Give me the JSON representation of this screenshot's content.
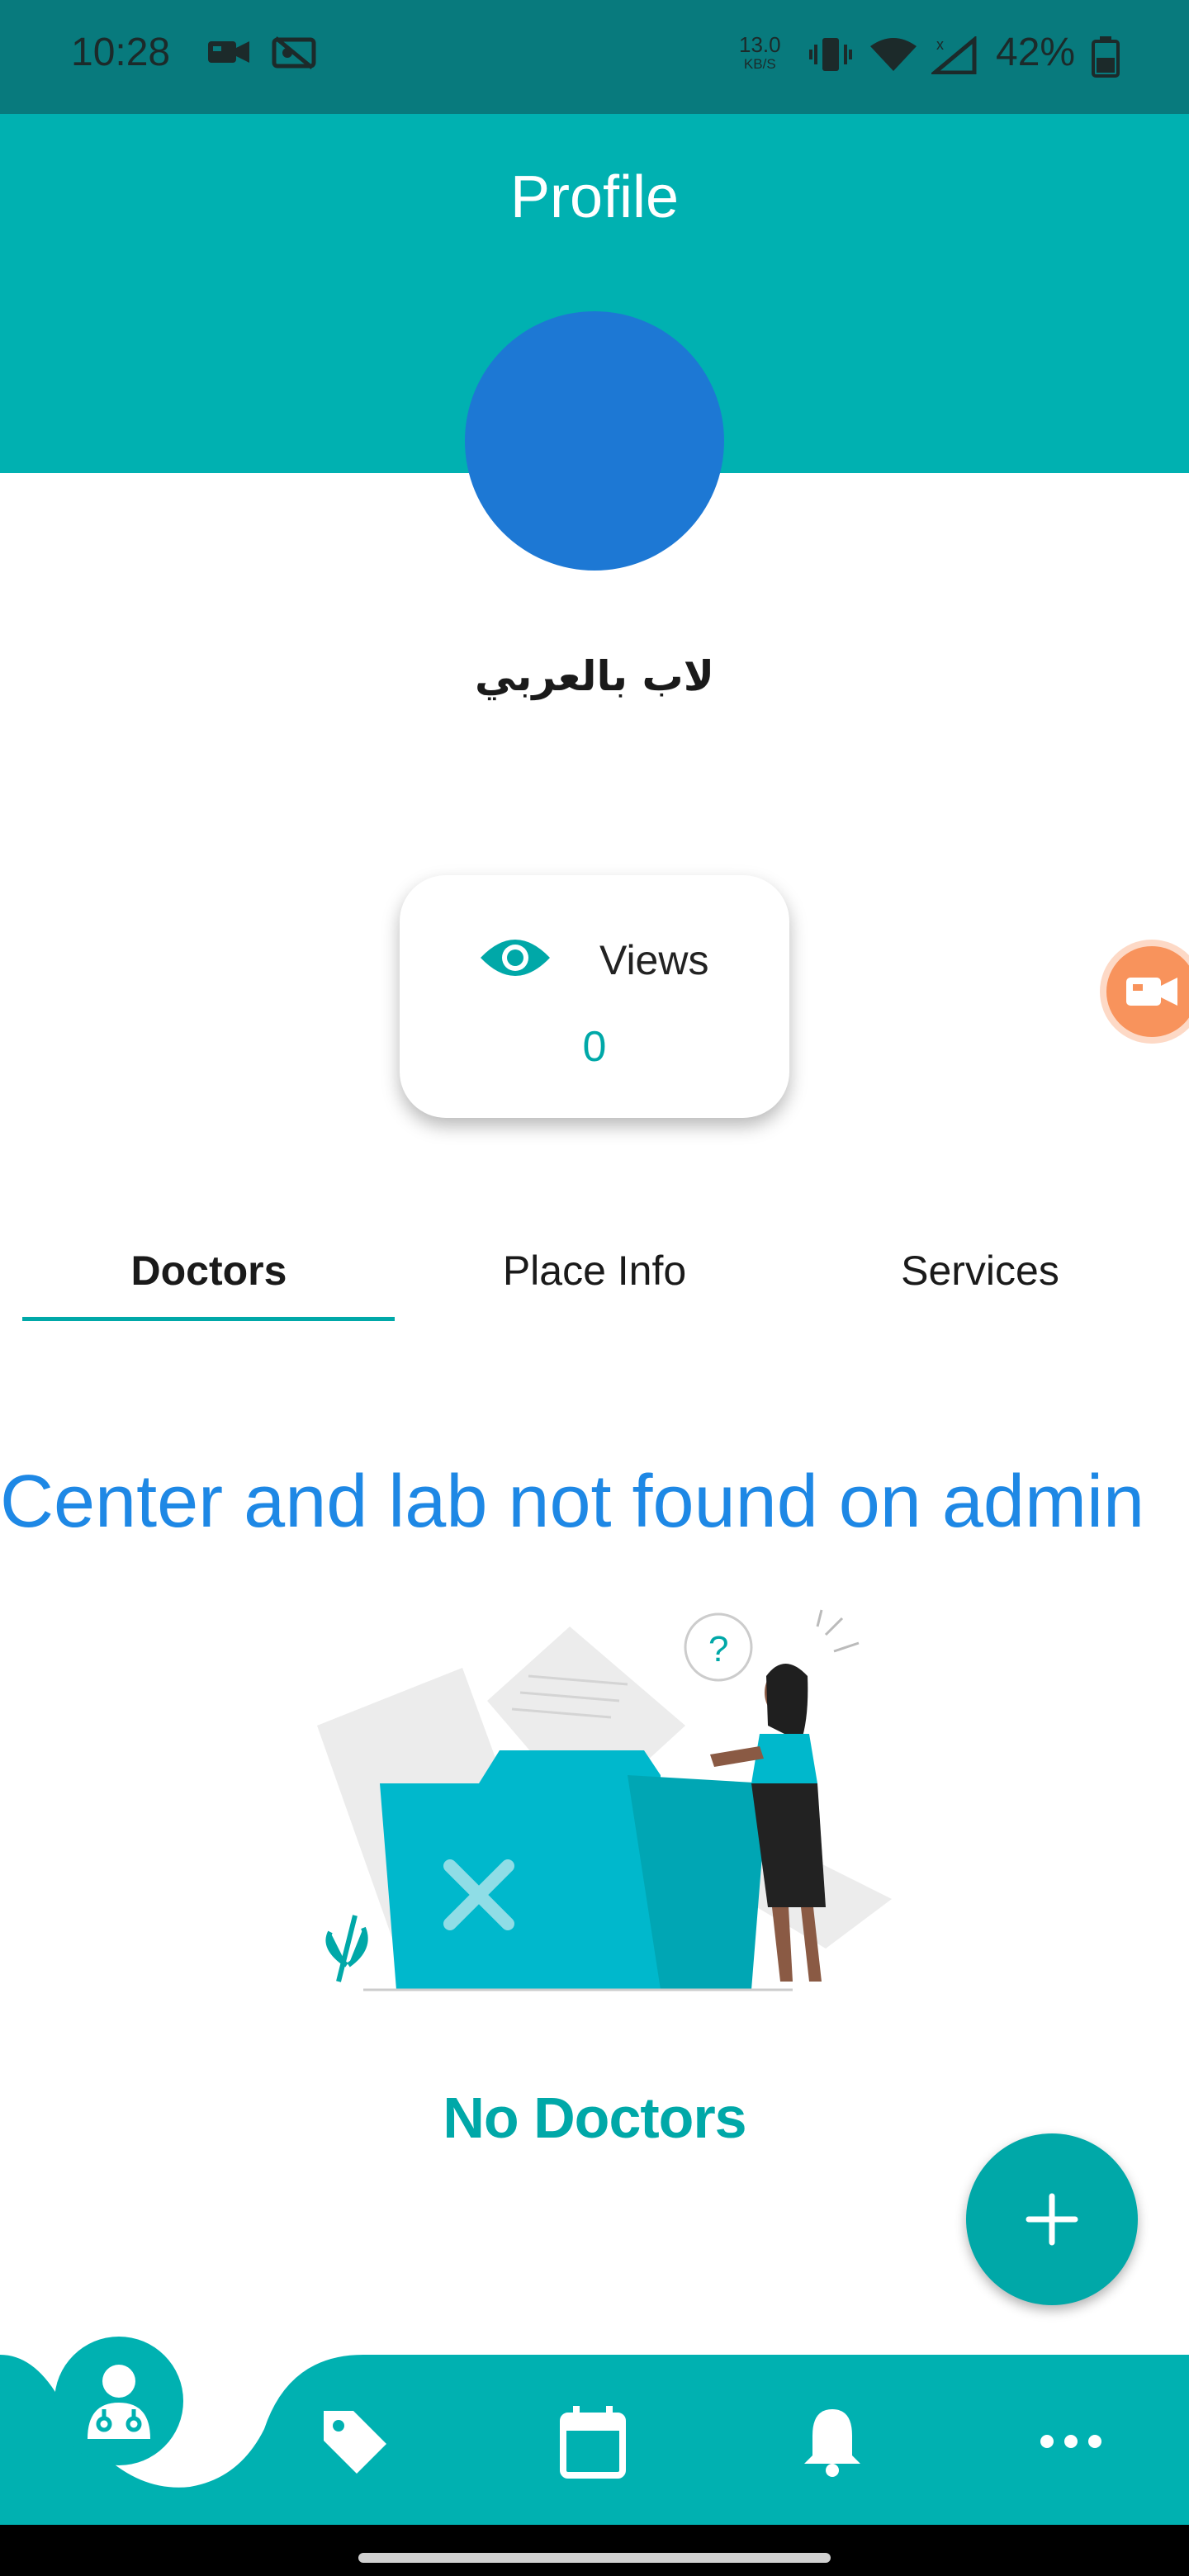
{
  "status_bar": {
    "time": "10:28",
    "net_speed_value": "13.0",
    "net_speed_unit": "KB/S",
    "battery": "42%",
    "icons": [
      "video-camera-icon",
      "cast-off-icon",
      "vibrate-icon",
      "wifi-icon",
      "signal-icon",
      "battery-icon"
    ]
  },
  "header": {
    "title": "Profile",
    "background_color": "#00b1b1"
  },
  "profile": {
    "name": "لاب بالعربي",
    "avatar_color": "#1d78d4"
  },
  "views_card": {
    "label": "Views",
    "count": "0",
    "icon": "eye-icon"
  },
  "tabs": [
    {
      "label": "Doctors",
      "active": true
    },
    {
      "label": "Place Info",
      "active": false
    },
    {
      "label": "Services",
      "active": false
    }
  ],
  "empty_state": {
    "heading": "Center and lab not found on admin",
    "title": "No Doctors",
    "illustration": "empty-folder-illustration"
  },
  "fab": {
    "icon": "plus-icon"
  },
  "bottom_nav": {
    "items": [
      {
        "icon": "doctor-icon",
        "active": true
      },
      {
        "icon": "tag-icon",
        "active": false
      },
      {
        "icon": "calendar-icon",
        "active": false
      },
      {
        "icon": "bell-icon",
        "active": false
      },
      {
        "icon": "more-icon",
        "active": false
      }
    ]
  },
  "colors": {
    "accent": "#00a8a8",
    "heading_blue": "#1e88e5",
    "status_bar": "#087a7d",
    "floating_video": "#f8935c"
  }
}
